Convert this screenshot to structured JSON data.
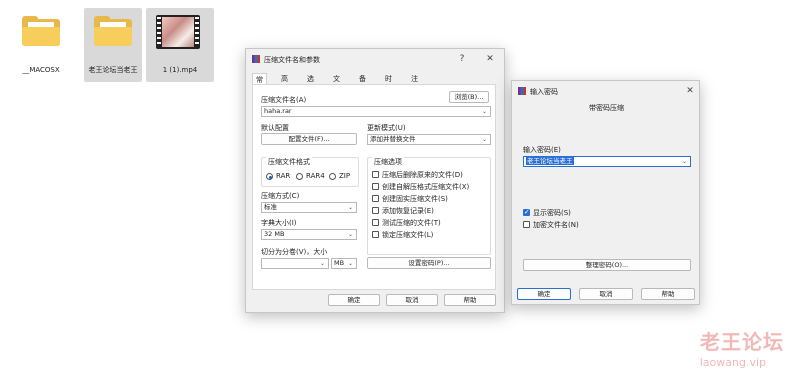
{
  "desktop": {
    "icons": [
      {
        "label": "__MACOSX",
        "type": "folder"
      },
      {
        "label": "老王论坛当老王",
        "type": "folder"
      },
      {
        "label": "1 (1).mp4",
        "type": "video"
      }
    ]
  },
  "archive_dialog": {
    "title": "压缩文件名和参数",
    "help_glyph": "?",
    "close_glyph": "✕",
    "tabs": [
      "常规",
      "高级",
      "选项",
      "文件",
      "备份",
      "时间",
      "注释"
    ],
    "archive_name_label": "压缩文件名(A)",
    "browse_label": "浏览(B)...",
    "archive_name_value": "haha.rar",
    "default_profile_label": "默认配置",
    "profile_button": "配置文件(F)...",
    "update_mode_label": "更新模式(U)",
    "update_mode_value": "添加并替换文件",
    "format_group_label": "压缩文件格式",
    "formats": [
      "RAR",
      "RAR4",
      "ZIP"
    ],
    "selected_format": "RAR",
    "options_group_label": "压缩选项",
    "options": [
      {
        "label": "压缩后删除原来的文件(D)",
        "checked": false
      },
      {
        "label": "创建自解压格式压缩文件(X)",
        "checked": false
      },
      {
        "label": "创建固实压缩文件(S)",
        "checked": false
      },
      {
        "label": "添加恢复记录(E)",
        "checked": false
      },
      {
        "label": "测试压缩的文件(T)",
        "checked": false
      },
      {
        "label": "锁定压缩文件(L)",
        "checked": false
      }
    ],
    "method_label": "压缩方式(C)",
    "method_value": "标准",
    "dict_label": "字典大小(I)",
    "dict_value": "32 MB",
    "split_label": "切分为分卷(V)，大小",
    "split_value": "",
    "split_unit": "MB",
    "set_password_button": "设置密码(P)...",
    "ok": "确定",
    "cancel": "取消",
    "help": "帮助"
  },
  "password_dialog": {
    "title": "输入密码",
    "close_glyph": "✕",
    "subtitle": "带密码压缩",
    "enter_label": "输入密码(E)",
    "password_value": "老王论坛当老王",
    "show_password_label": "显示密码(S)",
    "show_password_checked": true,
    "encrypt_names_label": "加密文件名(N)",
    "encrypt_names_checked": false,
    "organize_button": "整理密码(O)...",
    "ok": "确定",
    "cancel": "取消",
    "help": "帮助"
  },
  "watermark": {
    "line1": "老王论坛",
    "line2": "laowang.vip"
  },
  "colors": {
    "accent": "#2a6fd6",
    "folder": "#f7cd5c",
    "watermark": "#f2b8b8"
  }
}
